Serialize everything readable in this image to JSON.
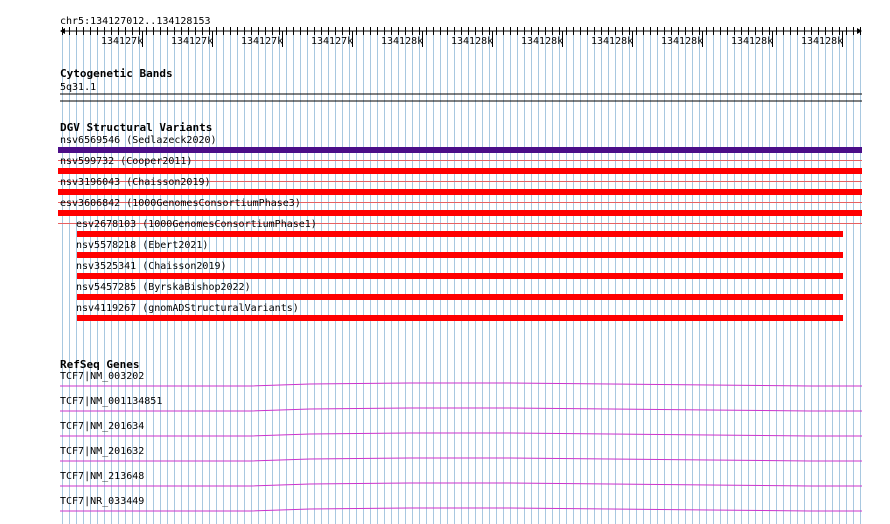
{
  "ruler": {
    "location": "chr5:134127012..134128153",
    "ticks": [
      "134127k",
      "134127k",
      "134127k",
      "134127k",
      "134128k",
      "134128k",
      "134128k",
      "134128k",
      "134128k",
      "134128k",
      "134128k"
    ]
  },
  "cytoband": {
    "title": "Cytogenetic Bands",
    "band": "5q31.1"
  },
  "dgv": {
    "title": "DGV Structural Variants",
    "variants": [
      {
        "label": "nsv6569546 (Sedlazeck2020)",
        "color": "#4b0e88",
        "indent": 0
      },
      {
        "label": "nsv599732 (Cooper2011)",
        "color": "#ff0000",
        "indent": 0
      },
      {
        "label": "nsv3196043 (Chaisson2019)",
        "color": "#ff0000",
        "indent": 0
      },
      {
        "label": "esv3606842 (1000GenomesConsortiumPhase3)",
        "color": "#ff0000",
        "indent": 0
      },
      {
        "label": "esv2678103 (1000GenomesConsortiumPhase1)",
        "color": "#ff0000",
        "indent": 1
      },
      {
        "label": "nsv5578218 (Ebert2021)",
        "color": "#ff0000",
        "indent": 1
      },
      {
        "label": "nsv3525341 (Chaisson2019)",
        "color": "#ff0000",
        "indent": 1
      },
      {
        "label": "nsv5457285 (ByrskaBishop2022)",
        "color": "#ff0000",
        "indent": 1
      },
      {
        "label": "nsv4119267 (gnomADStructuralVariants)",
        "color": "#ff0000",
        "indent": 1
      }
    ]
  },
  "refseq": {
    "title": "RefSeq Genes",
    "color": "#cc33cc",
    "genes": [
      "TCF7|NM_003202",
      "TCF7|NM_001134851",
      "TCF7|NM_201634",
      "TCF7|NM_201632",
      "TCF7|NM_213648",
      "TCF7|NR_033449"
    ]
  },
  "colors": {
    "grid": "#a8c8e0",
    "separator": "#000000"
  }
}
